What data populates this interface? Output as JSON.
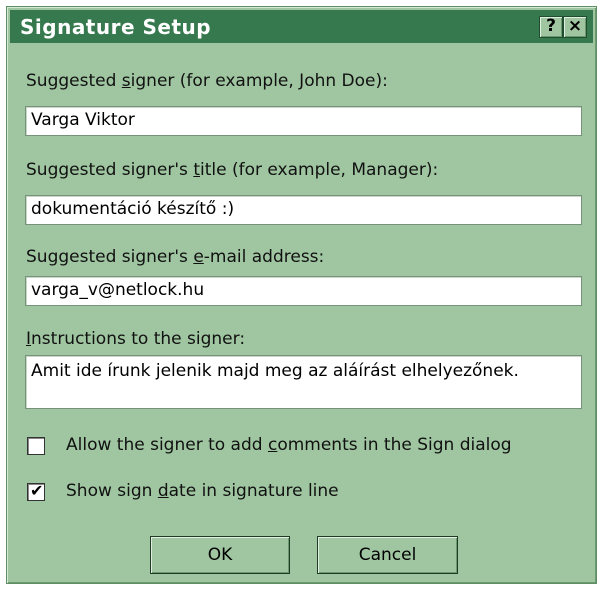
{
  "window": {
    "title": "Signature Setup",
    "help_label": "?",
    "close_label": "×"
  },
  "fields": {
    "signer": {
      "label_pre": "Suggested ",
      "label_key": "s",
      "label_post": "igner (for example, John Doe):",
      "value": "Varga Viktor"
    },
    "title": {
      "label_pre": "Suggested signer's ",
      "label_key": "t",
      "label_post": "itle (for example, Manager):",
      "value": "dokumentáció készítő :)"
    },
    "email": {
      "label_pre": "Suggested signer's ",
      "label_key": "e",
      "label_post": "-mail address:",
      "value": "varga_v@netlock.hu"
    },
    "instructions": {
      "label_pre": "",
      "label_key": "I",
      "label_post": "nstructions to the signer:",
      "value": "Amit ide írunk jelenik majd meg az aláírást elhelyezőnek."
    }
  },
  "options": {
    "allow_comments": {
      "label_pre": "Allow the signer to add ",
      "label_key": "c",
      "label_post": "omments in the Sign dialog",
      "checked": false,
      "mark": ""
    },
    "show_date": {
      "label_pre": "Show sign ",
      "label_key": "d",
      "label_post": "ate in signature line",
      "checked": true,
      "mark": "✔"
    }
  },
  "buttons": {
    "ok_label": "OK",
    "cancel_label": "Cancel"
  },
  "colors": {
    "dialog_bg": "#9fc6a1",
    "titlebar_bg": "#37794f",
    "title_text": "#ffffff"
  }
}
